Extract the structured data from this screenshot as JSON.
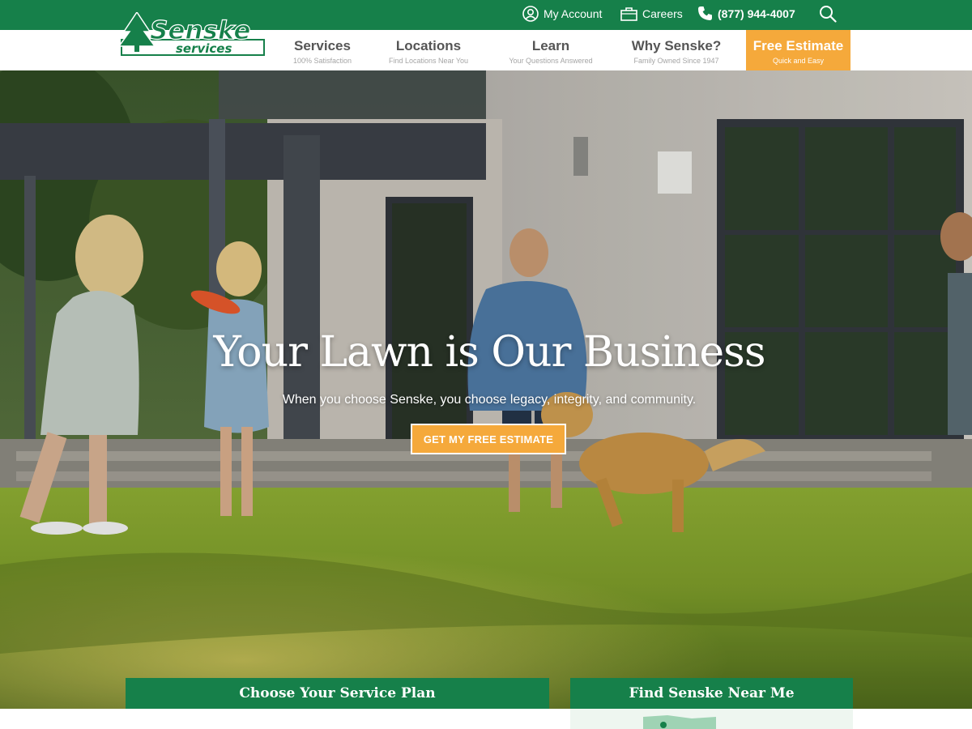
{
  "brand": {
    "name_line1": "Senske",
    "name_line2": "services",
    "green": "#16804a",
    "orange": "#f5a93b"
  },
  "utility": {
    "account_label": "My Account",
    "account_icon": "user-circle-icon",
    "careers_label": "Careers",
    "careers_icon": "briefcase-icon",
    "phone_label": "(877) 944-4007",
    "phone_icon": "phone-icon",
    "search_icon": "search-icon"
  },
  "nav": {
    "items": [
      {
        "title": "Services",
        "subtitle": "100% Satisfaction"
      },
      {
        "title": "Locations",
        "subtitle": "Find Locations Near You"
      },
      {
        "title": "Learn",
        "subtitle": "Your Questions Answered"
      },
      {
        "title": "Why Senske?",
        "subtitle": "Family Owned Since 1947"
      },
      {
        "title": "Free Estimate",
        "subtitle": "Quick and Easy"
      }
    ]
  },
  "hero": {
    "title": "Your Lawn is Our Business",
    "subtitle": "When you choose Senske, you choose legacy, integrity, and community.",
    "cta_label": "GET MY FREE ESTIMATE"
  },
  "cards": {
    "plan_title": "Choose Your Service Plan",
    "near_title": "Find Senske Near Me"
  }
}
